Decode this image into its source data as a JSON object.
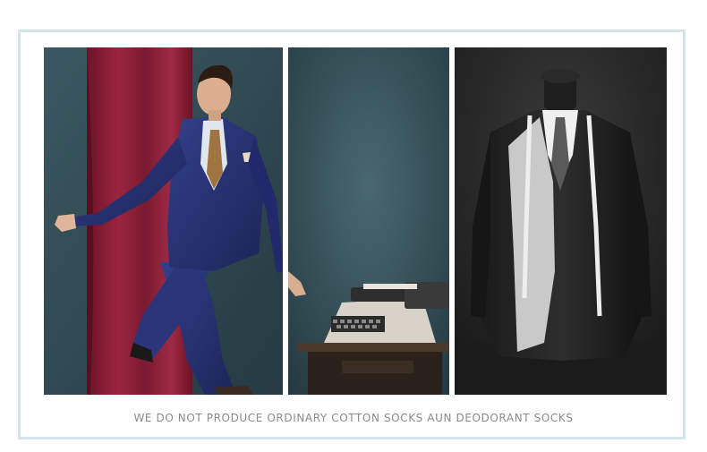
{
  "caption": "WE DO NOT PRODUCE ORDINARY COTTON SOCKS AUN DEODORANT SOCKS",
  "panels": [
    {
      "id": "left",
      "subject": "man-in-navy-suit-with-red-curtain"
    },
    {
      "id": "middle",
      "subject": "vintage-typewriter-on-desk"
    },
    {
      "id": "right",
      "subject": "mannequin-with-tailored-jacket-and-tape-measure"
    }
  ],
  "colors": {
    "frame_border": "#d3e3ea",
    "caption_text": "#8a8a8a",
    "suit_navy": "#26306e",
    "curtain_red": "#8c1f35",
    "backdrop_teal": "#2e4a52"
  }
}
